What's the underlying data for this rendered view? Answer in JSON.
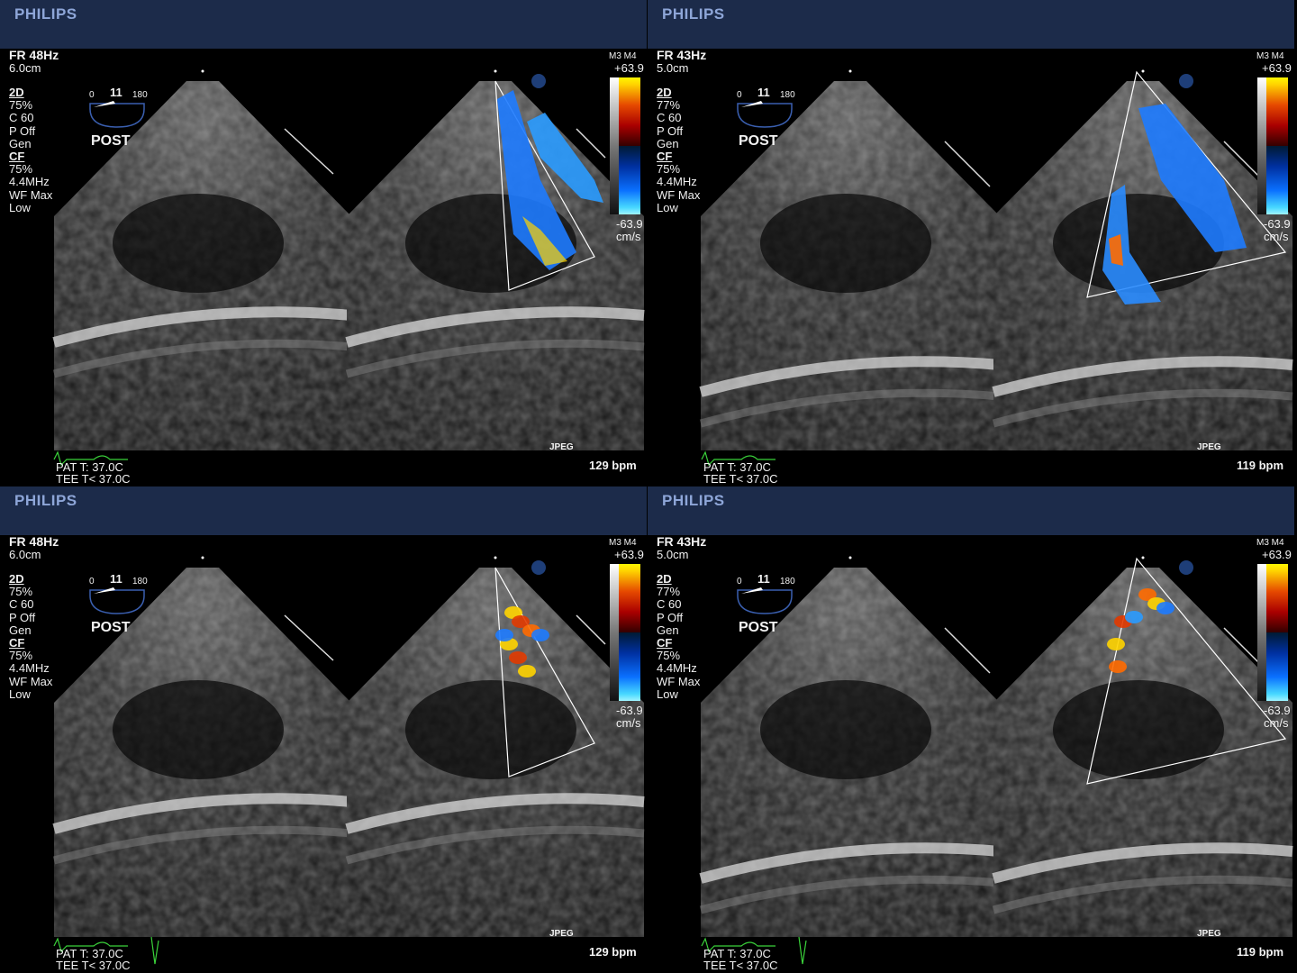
{
  "panels": [
    {
      "brand": "PHILIPS",
      "fr": "FR 48Hz",
      "depth": "6.0cm",
      "mode_2d": "2D",
      "gain_2d": " 75%",
      "compress": "C 60",
      "persist": "P Off",
      "gen": "Gen",
      "mode_cf": "CF",
      "gain_cf": " 75%",
      "freq": "4.4MHz",
      "wf": "WF Max",
      "low": "Low",
      "angle_min": "0",
      "angle": "11",
      "angle_max": "180",
      "orientation": "POST",
      "probe": "M3 M4",
      "scale_top": "+63.9",
      "scale_bottom": "-63.9",
      "scale_unit": "cm/s",
      "format": "JPEG",
      "pat_temp": "PAT T: 37.0C",
      "tee_temp": "TEE T< 37.0C",
      "hr": "129 bpm"
    },
    {
      "brand": "PHILIPS",
      "fr": "FR 43Hz",
      "depth": "5.0cm",
      "mode_2d": "2D",
      "gain_2d": " 77%",
      "compress": "C 60",
      "persist": "P Off",
      "gen": "Gen",
      "mode_cf": "CF",
      "gain_cf": " 75%",
      "freq": "4.4MHz",
      "wf": "WF Max",
      "low": "Low",
      "angle_min": "0",
      "angle": "11",
      "angle_max": "180",
      "orientation": "POST",
      "probe": "M3 M4",
      "scale_top": "+63.9",
      "scale_bottom": "-63.9",
      "scale_unit": "cm/s",
      "format": "JPEG",
      "pat_temp": "PAT T: 37.0C",
      "tee_temp": "TEE T< 37.0C",
      "hr": "119 bpm"
    },
    {
      "brand": "PHILIPS",
      "fr": "FR 48Hz",
      "depth": "6.0cm",
      "mode_2d": "2D",
      "gain_2d": " 75%",
      "compress": "C 60",
      "persist": "P Off",
      "gen": "Gen",
      "mode_cf": "CF",
      "gain_cf": " 75%",
      "freq": "4.4MHz",
      "wf": "WF Max",
      "low": "Low",
      "angle_min": "0",
      "angle": "11",
      "angle_max": "180",
      "orientation": "POST",
      "probe": "M3 M4",
      "scale_top": "+63.9",
      "scale_bottom": "-63.9",
      "scale_unit": "cm/s",
      "format": "JPEG",
      "pat_temp": "PAT T: 37.0C",
      "tee_temp": "TEE T< 37.0C",
      "hr": "129 bpm"
    },
    {
      "brand": "PHILIPS",
      "fr": "FR 43Hz",
      "depth": "5.0cm",
      "mode_2d": "2D",
      "gain_2d": " 77%",
      "compress": "C 60",
      "persist": "P Off",
      "gen": "Gen",
      "mode_cf": "CF",
      "gain_cf": " 75%",
      "freq": "4.4MHz",
      "wf": "WF Max",
      "low": "Low",
      "angle_min": "0",
      "angle": "11",
      "angle_max": "180",
      "orientation": "POST",
      "probe": "M3 M4",
      "scale_top": "+63.9",
      "scale_bottom": "-63.9",
      "scale_unit": "cm/s",
      "format": "JPEG",
      "pat_temp": "PAT T: 37.0C",
      "tee_temp": "TEE T< 37.0C",
      "hr": "119 bpm"
    }
  ],
  "colors": {
    "header_bg": "#1c2b4a",
    "brand": "#8ea6d8",
    "flow_blue": "#1e7bff",
    "flow_red": "#e23a00",
    "flow_yellow": "#ffd400",
    "ecg": "#3ad23a"
  },
  "flow_pattern": [
    "blue",
    "blue",
    "mosaic",
    "mosaic"
  ]
}
